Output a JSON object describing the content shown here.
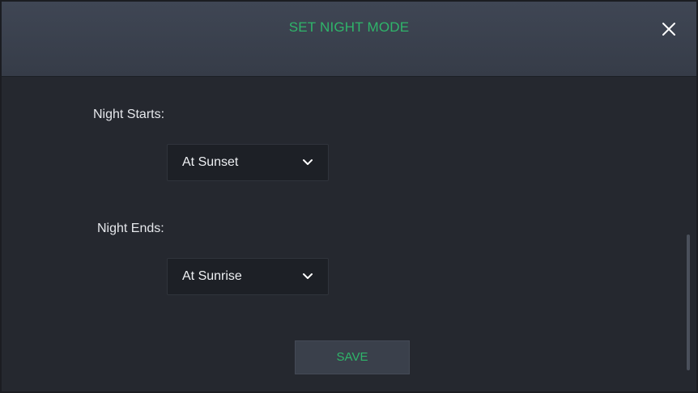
{
  "dialog": {
    "title": "SET NIGHT MODE",
    "close_icon": "close-icon"
  },
  "night_starts": {
    "label": "Night Starts:",
    "selected": "At Sunset",
    "icon": "chevron-down-icon"
  },
  "night_ends": {
    "label": "Night Ends:",
    "selected": "At Sunrise",
    "icon": "chevron-down-icon"
  },
  "actions": {
    "save_label": "SAVE"
  },
  "colors": {
    "accent": "#2fb56a",
    "header_bg": "#3a404c",
    "body_bg": "#25282f",
    "field_bg": "#1d2026",
    "text": "#e6e8ec"
  }
}
